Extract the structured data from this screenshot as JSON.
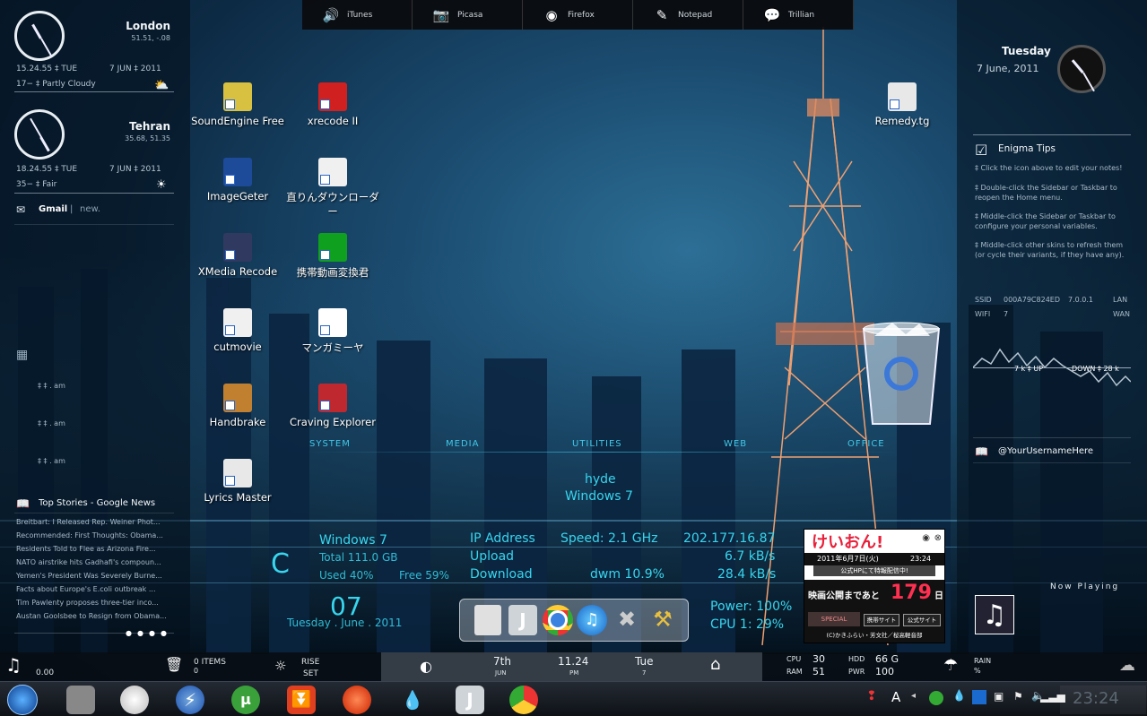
{
  "top_dock": [
    {
      "label": "iTunes",
      "icon": "speaker-icon"
    },
    {
      "label": "Picasa",
      "icon": "camera-icon"
    },
    {
      "label": "Firefox",
      "icon": "firefox-icon"
    },
    {
      "label": "Notepad",
      "icon": "pen-icon"
    },
    {
      "label": "Trillian",
      "icon": "chat-bubble-icon"
    }
  ],
  "left": {
    "london": {
      "city": "London",
      "coords": "51.51, -.08",
      "time": "15.24.55 ‡ TUE",
      "date": "7 JUN ‡ 2011",
      "weather": "17− ‡ Partly Cloudy"
    },
    "tehran": {
      "city": "Tehran",
      "coords": "35.68, 51.35",
      "time": "18.24.55 ‡ TUE",
      "date": "7 JUN ‡ 2011",
      "weather": "35− ‡ Fair"
    },
    "gmail": {
      "label": "Gmail",
      "sep": "|",
      "status": "new."
    },
    "calendar": [
      "‡ ‡ . am",
      "‡ ‡ . am",
      "‡ ‡ . am"
    ],
    "news": {
      "title": "Top Stories - Google News",
      "items": [
        "Breitbart: I Released Rep. Weiner Phot...",
        "Recommended: First Thoughts: Obama...",
        "Residents Told to Flee as Arizona Fire...",
        "NATO airstrike hits Gadhafi's compoun...",
        "Yemen's President Was Severely Burne...",
        "Facts about Europe's E.coli outbreak ...",
        "Tim Pawlenty proposes three-tier inco...",
        "Austan Goolsbee to Resign from Obama..."
      ]
    }
  },
  "right": {
    "day": "Tuesday",
    "date": "7 June, 2011",
    "tips": {
      "title": "Enigma Tips",
      "lines": [
        "‡ Click the icon above to edit your notes!",
        "‡ Double-click the Sidebar or Taskbar to reopen the Home menu.",
        "‡ Middle-click the Sidebar or Taskbar to configure your personal variables.",
        "‡ Middle-click other skins to refresh them (or cycle their variants, if they have any)."
      ]
    },
    "net": {
      "ssid": "SSID",
      "ssid_val": "000A79C824ED",
      "ip": "7.0.0.1",
      "lan": "LAN",
      "wifi": "WIFI",
      "wifi_val": "7",
      "wan": "WAN",
      "up": "7 k ‡ UP",
      "down": "DOWN ‡ 28 k"
    },
    "twitter": "@YourUsernameHere",
    "now_playing": "Now Playing"
  },
  "desktop_icons": [
    {
      "label": "SoundEngine Free",
      "color": "#d8c040"
    },
    {
      "label": "xrecode II",
      "color": "#d02020"
    },
    {
      "label": "ImageGeter",
      "color": "#1e4a9a"
    },
    {
      "label": "直りんダウンローダー",
      "color": "#ffffff"
    },
    {
      "label": "XMedia Recode",
      "color": "#303a60"
    },
    {
      "label": "携帯動画変換君",
      "color": "#10a020"
    },
    {
      "label": "cutmovie",
      "color": "#f0f0f0"
    },
    {
      "label": "マンガミーヤ",
      "color": "#ffffff"
    },
    {
      "label": "Handbrake",
      "color": "#c08030"
    },
    {
      "label": "Craving Explorer",
      "color": "#c02830"
    },
    {
      "label": "Lyrics Master",
      "color": "#e8e8e8"
    },
    {
      "label": "Remedy.tg",
      "color": "#e8e8e8"
    }
  ],
  "categories": [
    "SYSTEM",
    "MEDIA",
    "UTILITIES",
    "WEB",
    "OFFICE"
  ],
  "sysinfo": {
    "host": "hyde",
    "os": "Windows 7",
    "drive_letter": "C",
    "drive_os": "Windows 7",
    "total": "Total 111.0 GB",
    "used": "Used 40%",
    "free": "Free 59%",
    "day": "07",
    "date": "Tuesday . June . 2011",
    "ip_label": "IP Address",
    "ip": "202.177.16.87",
    "upload": "Upload",
    "upload_val": "6.7 kB/s",
    "download": "Download",
    "download_val": "28.4 kB/s",
    "speed": "Speed: 2.1 GHz",
    "dwm": "dwm 10.9%",
    "power": "Power: 100%",
    "cpu": "CPU 1: 29%"
  },
  "keion": {
    "logo": "けいおん!",
    "date": "2011年6月7日(火)",
    "time": "23:24",
    "sub": "公式HPにて特報配信中!",
    "count_pre": "映画公開まであと",
    "count": "179",
    "count_post": "日",
    "btn1": "SPECIAL",
    "btn2": "携帯サイト",
    "btn3": "公式サイト",
    "credit": "(C)かきふらい・芳文社／桜高軽音部"
  },
  "infobar": {
    "music_time": "0.00",
    "trash": "0 ITEMS",
    "trash_sub": "0",
    "rise": "RISE",
    "set": "SET",
    "date_day": "7th",
    "month": "JUN",
    "time": "11.24",
    "ampm": "PM",
    "weekday": "Tue",
    "weekday_num": "7",
    "cpu": "CPU",
    "cpu_val": "30",
    "ram": "RAM",
    "ram_val": "51",
    "hdd": "HDD",
    "hdd_val": "66 G",
    "pwr": "PWR",
    "pwr_val": "100",
    "rain": "RAIN",
    "rain_unit": "%"
  },
  "taskbar": {
    "clock": "23:24"
  }
}
